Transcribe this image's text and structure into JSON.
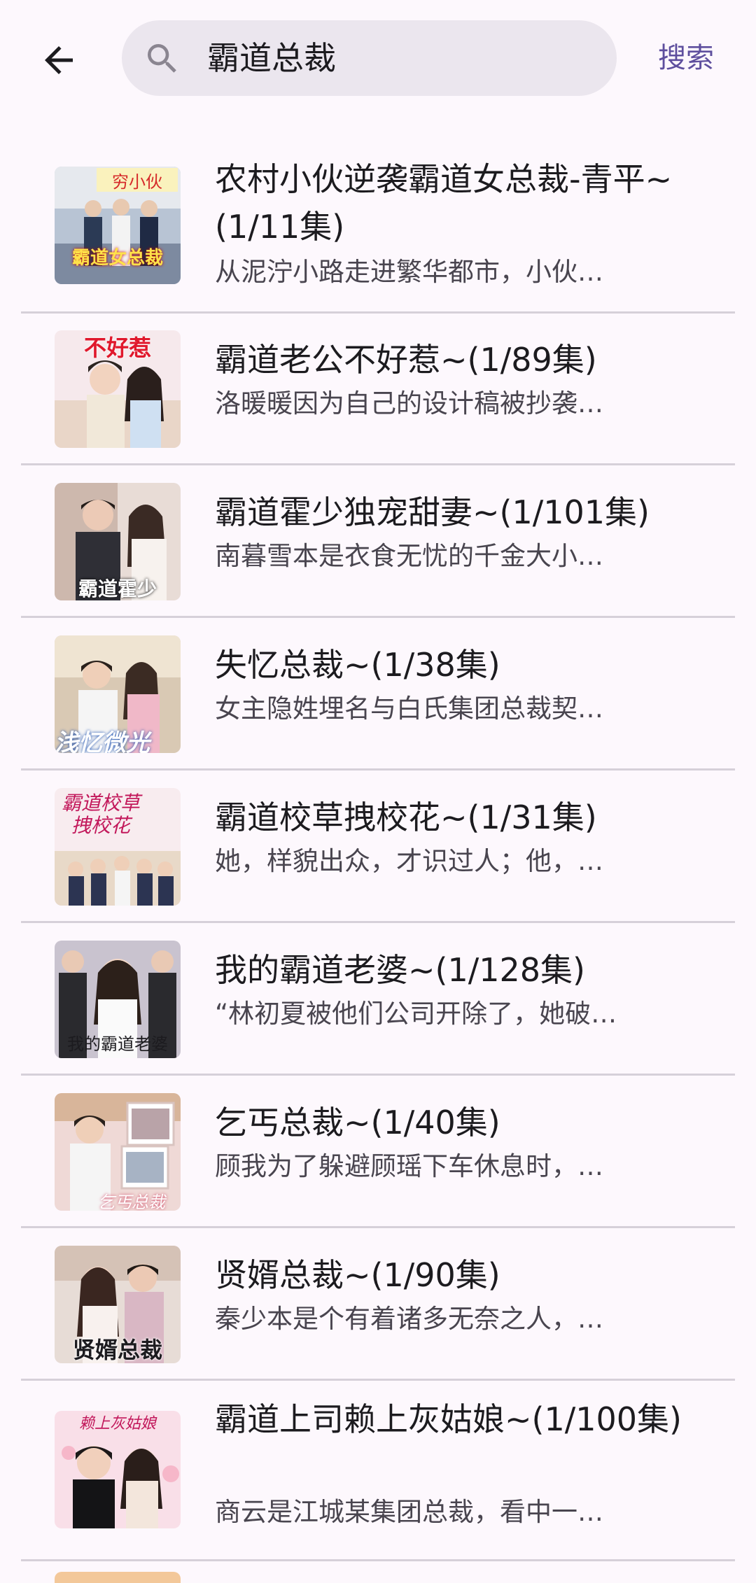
{
  "search": {
    "query": "霸道总裁",
    "button_label": "搜索"
  },
  "results": [
    {
      "title": "农村小伙逆袭霸道女总裁-青平~(1/11集)",
      "desc": "从泥泞小路走进繁华都市，小伙…",
      "poster_text": "霸道女总裁"
    },
    {
      "title": "霸道老公不好惹~(1/89集)",
      "desc": "洛暖暖因为自己的设计稿被抄袭…",
      "poster_text": "不好惹"
    },
    {
      "title": "霸道霍少独宠甜妻~(1/101集)",
      "desc": "南暮雪本是衣食无忧的千金大小…",
      "poster_text": "霸道霍少"
    },
    {
      "title": "失忆总裁~(1/38集)",
      "desc": "女主隐姓埋名与白氏集团总裁契…",
      "poster_text": "浅忆微光"
    },
    {
      "title": "霸道校草拽校花~(1/31集)",
      "desc": "她，样貌出众，才识过人；他，…",
      "poster_text": "霸道校草拽校花"
    },
    {
      "title": "我的霸道老婆~(1/128集)",
      "desc": "“林初夏被他们公司开除了，她破…",
      "poster_text": "我的霸道老婆"
    },
    {
      "title": "乞丐总裁~(1/40集)",
      "desc": "顾我为了躲避顾瑶下车休息时，…",
      "poster_text": "乞丐总裁"
    },
    {
      "title": "贤婿总裁~(1/90集)",
      "desc": "秦少本是个有着诸多无奈之人，…",
      "poster_text": "贤婿总裁"
    },
    {
      "title": "霸道上司赖上灰姑娘~(1/100集)",
      "desc": "商云是江城某集团总裁，看中一…",
      "poster_text": "赖上灰姑娘"
    }
  ],
  "colors": {
    "background": "#fdf8fd",
    "search_box": "#ebe6ee",
    "accent": "#5e4f9e",
    "divider": "#d6d0d9"
  }
}
